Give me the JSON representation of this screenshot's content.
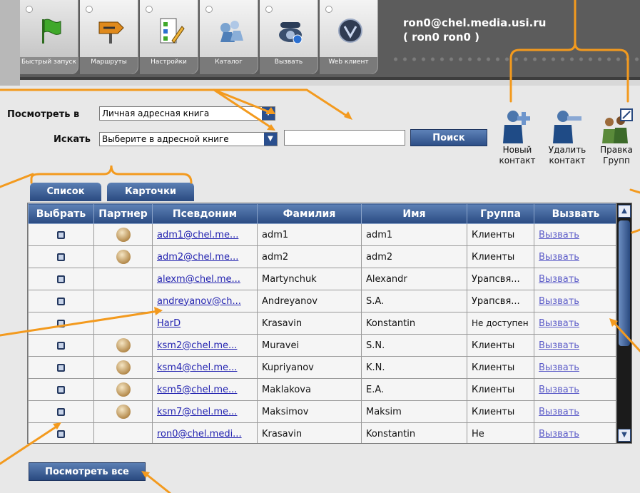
{
  "user": {
    "email": "ron0@chel.media.usi.ru",
    "display": "( ron0 ron0 )"
  },
  "toolbar": [
    {
      "label": "Быстрый запуск",
      "icon": "green-flag-icon"
    },
    {
      "label": "Маршруты",
      "icon": "route-sign-icon"
    },
    {
      "label": "Настройки",
      "icon": "checklist-pencil-icon"
    },
    {
      "label": "Каталог",
      "icon": "catalog-icon"
    },
    {
      "label": "Вызвать",
      "icon": "telephone-icon"
    },
    {
      "label": "Web клиент",
      "icon": "web-client-icon"
    }
  ],
  "search": {
    "view_label": "Посмотреть в",
    "view_value": "Личная адресная книга",
    "find_label": "Искать",
    "find_value": "Выберите в адресной книге",
    "button": "Поиск"
  },
  "contact_actions": [
    {
      "label": "Новый контакт",
      "icon": "add-contact-icon"
    },
    {
      "label": "Удалить контакт",
      "icon": "remove-contact-icon"
    },
    {
      "label": "Правка Групп",
      "icon": "edit-groups-icon"
    }
  ],
  "tabs": [
    "Список",
    "Карточки"
  ],
  "table": {
    "columns": [
      "Выбрать",
      "Партнер",
      "Псевдоним",
      "Фамилия",
      "Имя",
      "Группа",
      "Вызвать"
    ],
    "rows": [
      {
        "partner": true,
        "alias": "adm1@chel.me...",
        "last": "adm1",
        "first": "adm1",
        "group": "Клиенты",
        "call": "Вызвать"
      },
      {
        "partner": true,
        "alias": "adm2@chel.me...",
        "last": "adm2",
        "first": "adm2",
        "group": "Клиенты",
        "call": "Вызвать"
      },
      {
        "partner": false,
        "alias": "alexm@chel.me...",
        "last": "Martynchuk",
        "first": "Alexandr",
        "group": "Урапсвя...",
        "call": "Вызвать"
      },
      {
        "partner": false,
        "alias": "andreyanov@ch...",
        "last": "Andreyanov",
        "first": "S.A.",
        "group": "Урапсвя...",
        "call": "Вызвать"
      },
      {
        "partner": false,
        "alias": "HarD",
        "last": "Krasavin",
        "first": "Konstantin",
        "group": "Не доступен",
        "call": "Вызвать"
      },
      {
        "partner": true,
        "alias": "ksm2@chel.me...",
        "last": "Muravei",
        "first": "S.N.",
        "group": "Клиенты",
        "call": "Вызвать"
      },
      {
        "partner": true,
        "alias": "ksm4@chel.me...",
        "last": "Kupriyanov",
        "first": "K.N.",
        "group": "Клиенты",
        "call": "Вызвать"
      },
      {
        "partner": true,
        "alias": "ksm5@chel.me...",
        "last": "Maklakova",
        "first": "E.A.",
        "group": "Клиенты",
        "call": "Вызвать"
      },
      {
        "partner": true,
        "alias": "ksm7@chel.me...",
        "last": "Maksimov",
        "first": "Maksim",
        "group": "Клиенты",
        "call": "Вызвать"
      },
      {
        "partner": false,
        "alias": "ron0@chel.medi...",
        "last": "Krasavin",
        "first": "Konstantin",
        "group": "Не",
        "call": "Вызвать"
      }
    ]
  },
  "view_all": "Посмотреть все",
  "colors": {
    "accent": "#2a4a80",
    "annotation": "#f39a1e"
  }
}
